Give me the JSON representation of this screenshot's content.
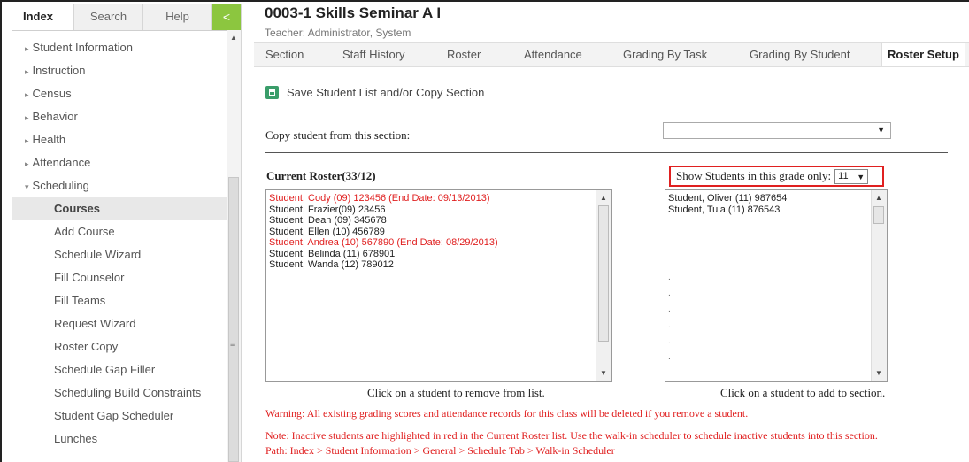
{
  "sidebar": {
    "tabs": {
      "index": "Index",
      "search": "Search",
      "help": "Help",
      "collapse": "<"
    },
    "items": [
      {
        "label": "Student Information",
        "arrow": "▸"
      },
      {
        "label": "Instruction",
        "arrow": "▸"
      },
      {
        "label": "Census",
        "arrow": "▸"
      },
      {
        "label": "Behavior",
        "arrow": "▸"
      },
      {
        "label": "Health",
        "arrow": "▸"
      },
      {
        "label": "Attendance",
        "arrow": "▸"
      },
      {
        "label": "Scheduling",
        "arrow": "▾"
      }
    ],
    "sub_items": [
      "Courses",
      "Add Course",
      "Schedule Wizard",
      "Fill Counselor",
      "Fill Teams",
      "Request Wizard",
      "Roster Copy",
      "Schedule Gap Filler",
      "Scheduling Build Constraints",
      "Student Gap Scheduler",
      "Lunches"
    ],
    "active_sub_item": "Courses"
  },
  "header": {
    "title": "0003-1 Skills Seminar A I",
    "teacher": "Teacher: Administrator, System"
  },
  "section_tabs": [
    "Section",
    "Staff History",
    "Roster",
    "Attendance",
    "Grading By Task",
    "Grading By Student",
    "Roster Setup"
  ],
  "active_tab": "Roster Setup",
  "toolbar": {
    "save_label": "Save Student List and/or Copy Section",
    "save_icon": "save-icon"
  },
  "copy": {
    "label": "Copy student from this section:",
    "value": ""
  },
  "roster": {
    "title": "Current Roster(33/12)",
    "students": [
      {
        "text": "Student, Cody (09) 123456 (End Date: 09/13/2013)",
        "inactive": true
      },
      {
        "text": "Student, Frazier(09) 23456",
        "inactive": false
      },
      {
        "text": "Student, Dean (09) 345678",
        "inactive": false
      },
      {
        "text": "Student, Ellen (10) 456789",
        "inactive": false
      },
      {
        "text": "Student, Andrea (10) 567890 (End Date: 08/29/2013)",
        "inactive": true
      },
      {
        "text": "Student, Belinda (11) 678901",
        "inactive": false
      },
      {
        "text": "Student, Wanda (12) 789012",
        "inactive": false
      }
    ],
    "caption": "Click on a student to remove from list."
  },
  "grade_filter": {
    "label": "Show Students in this grade only:",
    "value": "11"
  },
  "available": {
    "students": [
      "Student, Oliver (11) 987654",
      "Student, Tula (11) 876543"
    ],
    "caption": "Click on a student to add to section."
  },
  "notes": {
    "warning": "Warning: All existing grading scores and attendance records for this class will be deleted if you remove a student.",
    "inactive_note": "Note: Inactive students are highlighted in red in the Current Roster list. Use the walk-in scheduler to schedule inactive students into this section.",
    "path": "Path: Index > Student Information > General > Schedule Tab > Walk-in Scheduler"
  },
  "colors": {
    "accent": "#8cc63f",
    "warning": "#e02020",
    "save_icon": "#3a9d6a"
  }
}
